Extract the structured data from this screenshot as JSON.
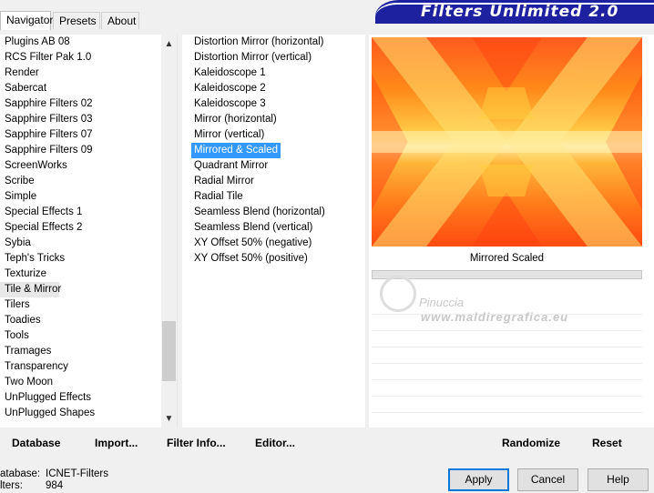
{
  "tabs": [
    {
      "label": "Navigator",
      "active": true
    },
    {
      "label": "Presets",
      "active": false
    },
    {
      "label": "About",
      "active": false
    }
  ],
  "banner": {
    "title": "Filters Unlimited 2.0"
  },
  "categories": [
    "Plugins AB 08",
    "RCS Filter Pak 1.0",
    "Render",
    "Sabercat",
    "Sapphire Filters 02",
    "Sapphire Filters 03",
    "Sapphire Filters 07",
    "Sapphire Filters 09",
    "ScreenWorks",
    "Scribe",
    "Simple",
    "Special Effects 1",
    "Special Effects 2",
    "Sybia",
    "Teph's Tricks",
    "Texturize",
    "Tile & Mirror",
    "Tilers",
    "Toadies",
    "Tools",
    "Tramages",
    "Transparency",
    "Two Moon",
    "UnPlugged Effects",
    "UnPlugged Shapes"
  ],
  "selected_category": "Tile & Mirror",
  "filters": [
    "Distortion Mirror (horizontal)",
    "Distortion Mirror (vertical)",
    "Kaleidoscope 1",
    "Kaleidoscope 2",
    "Kaleidoscope 3",
    "Mirror (horizontal)",
    "Mirror (vertical)",
    "Mirrored & Scaled",
    "Quadrant Mirror",
    "Radial Mirror",
    "Radial Tile",
    "Seamless Blend (horizontal)",
    "Seamless Blend (vertical)",
    "XY Offset 50% (negative)",
    "XY Offset 50% (positive)"
  ],
  "selected_filter": "Mirrored & Scaled",
  "preview": {
    "label": "Mirrored  Scaled"
  },
  "watermark": {
    "line1": "Pinuccia",
    "line2": "www.maldiregrafica.eu"
  },
  "bottom_links": {
    "database": "Database",
    "import": "Import...",
    "filter_info": "Filter Info...",
    "editor": "Editor..."
  },
  "right_links": {
    "randomize": "Randomize",
    "reset": "Reset"
  },
  "status": {
    "database_label": "atabase:",
    "database_value": "ICNET-Filters",
    "filters_label": "lters:",
    "filters_value": "984"
  },
  "buttons": {
    "apply": "Apply",
    "cancel": "Cancel",
    "help": "Help"
  },
  "colors": {
    "banner": "#1d21a0",
    "selection": "#3399ff"
  }
}
